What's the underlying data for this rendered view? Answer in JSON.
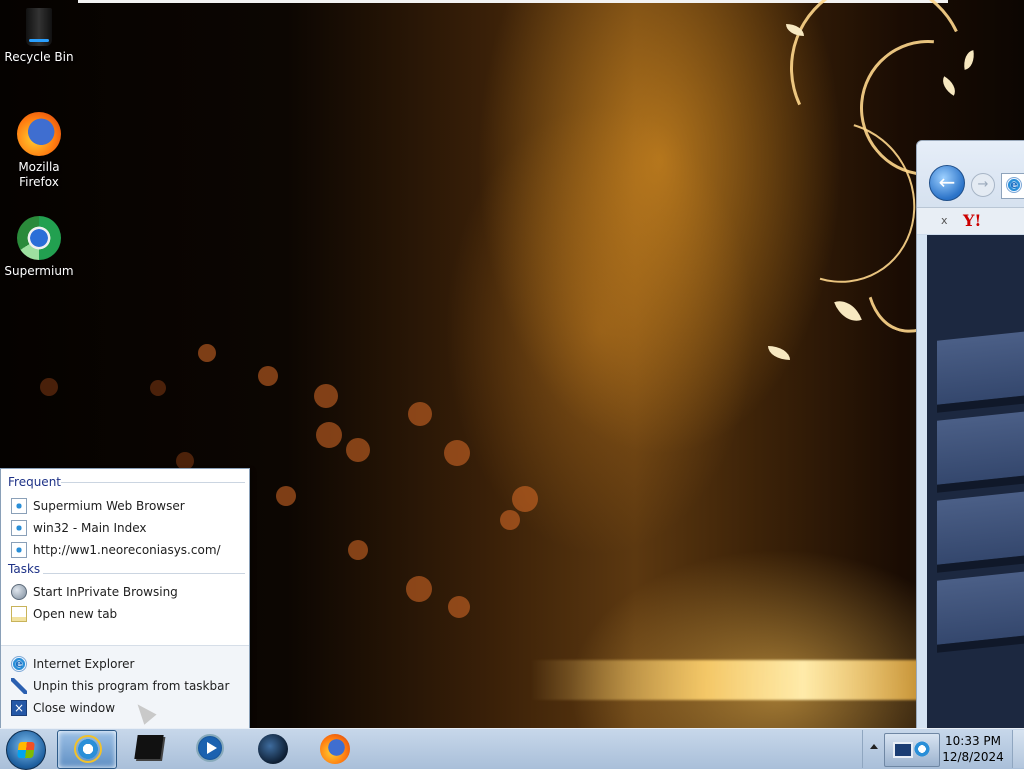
{
  "desktop": {
    "icons": [
      {
        "label": "Recycle Bin",
        "icon": "recycle-bin-icon"
      },
      {
        "label": "Mozilla Firefox",
        "icon": "firefox-icon"
      },
      {
        "label": "Supermium",
        "icon": "supermium-icon"
      }
    ]
  },
  "browser_window": {
    "back_icon": "back-arrow-icon",
    "forward_icon": "forward-arrow-icon",
    "tab_close": "x",
    "toolbar_logo": "Y!"
  },
  "jumplist": {
    "frequent_header": "Frequent",
    "frequent": [
      {
        "label": "Supermium Web Browser",
        "icon": "ie-page-icon"
      },
      {
        "label": "win32 - Main Index",
        "icon": "ie-page-icon"
      },
      {
        "label": "http://ww1.neoreconiasys.com/",
        "icon": "ie-page-icon"
      }
    ],
    "tasks_header": "Tasks",
    "tasks": [
      {
        "label": "Start InPrivate Browsing",
        "icon": "inprivate-icon"
      },
      {
        "label": "Open new tab",
        "icon": "new-tab-icon"
      }
    ],
    "actions": [
      {
        "label": "Internet Explorer",
        "icon": "internet-explorer-icon"
      },
      {
        "label": "Unpin this program from taskbar",
        "icon": "unpin-icon"
      },
      {
        "label": "Close window",
        "icon": "close-window-icon"
      }
    ]
  },
  "taskbar": {
    "start_icon": "windows-start-icon",
    "pinned": [
      {
        "name": "Internet Explorer",
        "icon": "internet-explorer-icon",
        "active": true
      },
      {
        "name": "Command window",
        "icon": "console-icon",
        "active": false
      },
      {
        "name": "Windows Media Player",
        "icon": "media-player-icon",
        "active": false
      },
      {
        "name": "Supermium",
        "icon": "supermium-icon",
        "active": false
      },
      {
        "name": "Mozilla Firefox",
        "icon": "firefox-icon",
        "active": false
      }
    ],
    "clock": {
      "time": "10:33 PM",
      "date": "12/8/2024"
    }
  }
}
